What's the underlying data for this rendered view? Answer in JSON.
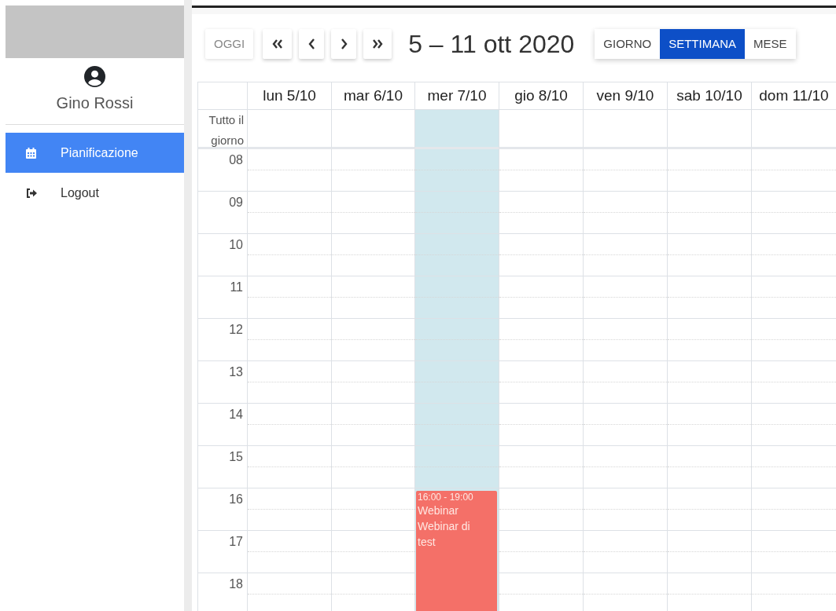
{
  "sidebar": {
    "user_name": "Gino Rossi",
    "items": [
      {
        "label": "Pianificazione",
        "kind": "calendar",
        "selected": true
      },
      {
        "label": "Logout",
        "kind": "logout",
        "selected": false
      }
    ]
  },
  "toolbar": {
    "today_button": {
      "label": "OGGI",
      "disabled": true
    },
    "title": "5 – 11 ott 2020",
    "views": [
      {
        "label": "GIORNO",
        "selected": false
      },
      {
        "label": "SETTIMANA",
        "selected": true
      },
      {
        "label": "MESE",
        "selected": false
      }
    ]
  },
  "calendar": {
    "all_day_label": "Tutto il giorno",
    "days": [
      {
        "label": "lun 5/10",
        "today": false
      },
      {
        "label": "mar 6/10",
        "today": false
      },
      {
        "label": "mer 7/10",
        "today": true,
        "events": [
          {
            "time": "16:00 - 19:00",
            "title": "Webinar",
            "description": "Webinar di test",
            "color": "#f47068"
          }
        ]
      },
      {
        "label": "gio 8/10",
        "today": false
      },
      {
        "label": "ven 9/10",
        "today": false
      },
      {
        "label": "sab 10/10",
        "today": false
      },
      {
        "label": "dom 11/10",
        "today": false
      }
    ],
    "hours": [
      "08",
      "09",
      "10",
      "11",
      "12",
      "13",
      "14",
      "15",
      "16",
      "17",
      "18"
    ]
  }
}
